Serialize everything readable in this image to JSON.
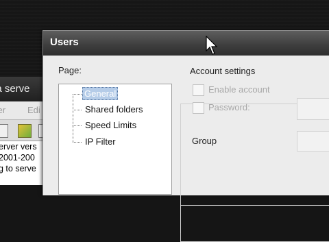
{
  "background_app": {
    "title_fragment": "la serve",
    "menu": [
      "ver",
      "Edi"
    ],
    "log_lines": [
      "erver vers",
      "2001-200",
      "g to serve"
    ]
  },
  "dialog": {
    "title": "Users",
    "page_label": "Page:",
    "pages": [
      "General",
      "Shared folders",
      "Speed Limits",
      "IP Filter"
    ],
    "selected_page": "General",
    "account_settings_label": "Account settings",
    "enable_account_label": "Enable account",
    "password_label": "Password:",
    "group_label": "Group"
  },
  "colors": {
    "title_bar": "#3d3d3d",
    "dialog_bg": "#ececec",
    "selection": "#b5cce8"
  }
}
